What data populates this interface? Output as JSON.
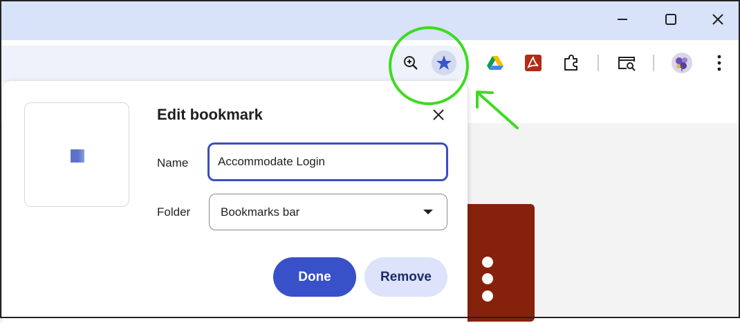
{
  "window": {
    "controls": [
      "minimize-icon",
      "maximize-icon",
      "close-icon"
    ]
  },
  "toolbar": {
    "icons": [
      "zoom-in-icon",
      "bookmark-star-icon",
      "google-drive-icon",
      "adobe-pdf-icon",
      "extensions-puzzle-icon",
      "search-tab-icon",
      "profile-avatar-icon",
      "more-menu-icon"
    ],
    "star_color": "#3a55c8"
  },
  "dialog": {
    "title": "Edit bookmark",
    "name_label": "Name",
    "name_value": "Accommodate Login",
    "folder_label": "Folder",
    "folder_value": "Bookmarks bar",
    "done_label": "Done",
    "remove_label": "Remove"
  },
  "colors": {
    "accent": "#3850c8",
    "highlight": "#3cdc1e",
    "page_card": "#86220c"
  }
}
